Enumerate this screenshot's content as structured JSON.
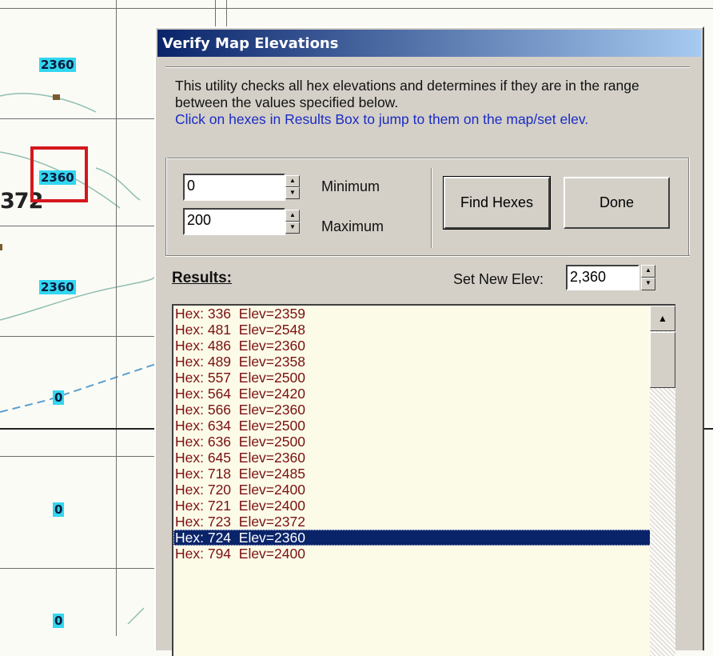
{
  "map": {
    "elevation_labels": [
      "2360",
      "2360",
      "2360",
      "0",
      "0",
      "0"
    ],
    "hex_number_fragment": "372",
    "colors": {
      "label_bg": "#33d6f0",
      "selection": "#d4171c"
    }
  },
  "dialog": {
    "title": "Verify Map Elevations",
    "description": "This utility checks all hex elevations and determines if they are in the range between the values specified below.",
    "hint": "Click on hexes in Results Box to jump to them on the map/set elev.",
    "minimum": {
      "value": "0",
      "label": "Minimum"
    },
    "maximum": {
      "value": "200",
      "label": "Maximum"
    },
    "find_button": "Find Hexes",
    "done_button": "Done",
    "results_label": "Results:",
    "set_new_elev_label": "Set New Elev:",
    "set_new_elev_value": "2,360",
    "results": [
      "Hex: 336  Elev=2359",
      "Hex: 481  Elev=2548",
      "Hex: 486  Elev=2360",
      "Hex: 489  Elev=2358",
      "Hex: 557  Elev=2500",
      "Hex: 564  Elev=2420",
      "Hex: 566  Elev=2360",
      "Hex: 634  Elev=2500",
      "Hex: 636  Elev=2500",
      "Hex: 645  Elev=2360",
      "Hex: 718  Elev=2485",
      "Hex: 720  Elev=2400",
      "Hex: 721  Elev=2400",
      "Hex: 723  Elev=2372",
      "Hex: 724  Elev=2360",
      "Hex: 794  Elev=2400"
    ],
    "selected_result": "Hex: 724  Elev=2360",
    "icons": {
      "spin_up": "spin-up-arrow-icon",
      "spin_down": "spin-down-arrow-icon",
      "scroll_up": "scroll-up-arrow-icon"
    },
    "colors": {
      "title_start": "#0a246a",
      "title_end": "#a6caf0",
      "hint": "#1a2bc4",
      "result_text": "#7a1010",
      "list_bg": "#fcfbe8"
    }
  }
}
